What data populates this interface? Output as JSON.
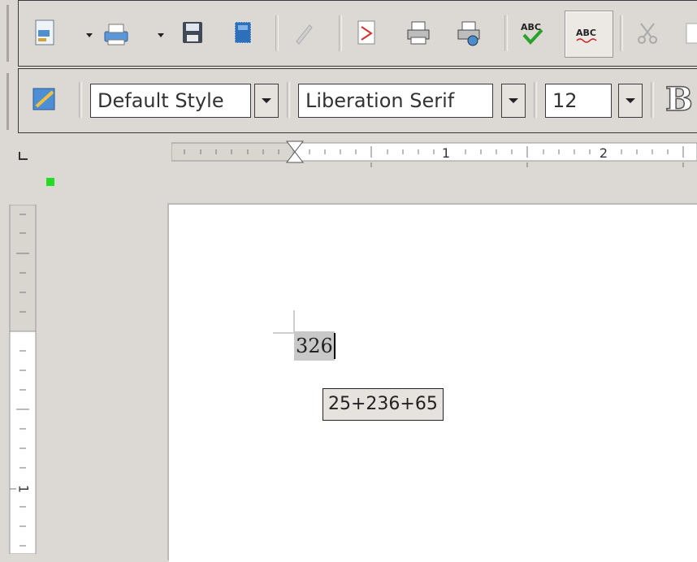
{
  "toolbar_standard": {
    "icons": [
      "new-document-icon",
      "save-disk-icon",
      "print-icon",
      "template-icon",
      "edit-pencil-icon",
      "export-pdf-icon",
      "print-direct-icon",
      "print-preview-icon",
      "spellcheck-icon",
      "autospellcheck-icon",
      "cut-scissors-icon"
    ]
  },
  "toolbar_formatting": {
    "paragraph_style": "Default Style",
    "font_name": "Liberation Serif",
    "font_size": "12",
    "bold_label": "B"
  },
  "ruler": {
    "horizontal_labels": [
      "1",
      "2"
    ],
    "vertical_labels": [
      "1"
    ]
  },
  "document": {
    "cell_text": "326",
    "formula_tooltip": "25+236+65"
  },
  "colors": {
    "background": "#dcd8d3",
    "selection": "#c8c8c8",
    "marker_green": "#22dd22"
  }
}
